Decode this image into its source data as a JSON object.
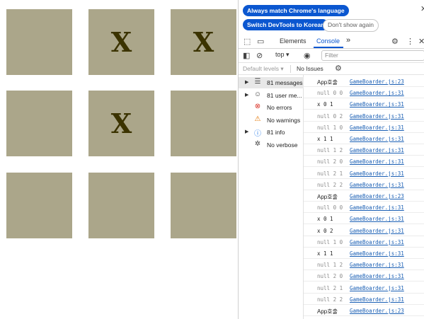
{
  "board": {
    "cells": [
      "",
      "X",
      "X",
      "",
      "X",
      "",
      "",
      "",
      ""
    ]
  },
  "devtools": {
    "banner": {
      "match_language": "Always match Chrome's language",
      "switch_korean": "Switch DevTools to Korean",
      "dont_show": "Don't show again"
    },
    "tabs": {
      "elements": "Elements",
      "console": "Console",
      "more": "»"
    },
    "toolbar": {
      "context": "top ▾",
      "filter_placeholder": "Filter"
    },
    "levels": "Default levels ▾",
    "issues": "No Issues",
    "sidebar": [
      {
        "label": "81 messages",
        "icon": "list-icon",
        "glyph": "☰",
        "arrow": true,
        "selected": true,
        "color": "#444444"
      },
      {
        "label": "81 user me...",
        "icon": "user-icon",
        "glyph": "☺",
        "arrow": true,
        "selected": false,
        "color": "#444444"
      },
      {
        "label": "No errors",
        "icon": "error-icon",
        "glyph": "⊗",
        "arrow": false,
        "selected": false,
        "color": "#d93025"
      },
      {
        "label": "No warnings",
        "icon": "warning-icon",
        "glyph": "⚠",
        "arrow": false,
        "selected": false,
        "color": "#e37400"
      },
      {
        "label": "81 info",
        "icon": "info-icon",
        "glyph": "ⓘ",
        "arrow": true,
        "selected": false,
        "color": "#1a73e8"
      },
      {
        "label": "No verbose",
        "icon": "bug-icon",
        "glyph": "✲",
        "arrow": false,
        "selected": false,
        "color": "#444444"
      }
    ],
    "log": [
      {
        "msg": "App호출",
        "src": "GameBoarder.js:23",
        "kind": "plain"
      },
      {
        "msg": "null 0 0",
        "src": "GameBoarder.js:31",
        "kind": "dim"
      },
      {
        "msg": "x 0 1",
        "src": "GameBoarder.js:31",
        "kind": "normal"
      },
      {
        "msg": "null 0 2",
        "src": "GameBoarder.js:31",
        "kind": "dim"
      },
      {
        "msg": "null 1 0",
        "src": "GameBoarder.js:31",
        "kind": "dim"
      },
      {
        "msg": "x 1 1",
        "src": "GameBoarder.js:31",
        "kind": "normal"
      },
      {
        "msg": "null 1 2",
        "src": "GameBoarder.js:31",
        "kind": "dim"
      },
      {
        "msg": "null 2 0",
        "src": "GameBoarder.js:31",
        "kind": "dim"
      },
      {
        "msg": "null 2 1",
        "src": "GameBoarder.js:31",
        "kind": "dim"
      },
      {
        "msg": "null 2 2",
        "src": "GameBoarder.js:31",
        "kind": "dim"
      },
      {
        "msg": "App호출",
        "src": "GameBoarder.js:23",
        "kind": "plain"
      },
      {
        "msg": "null 0 0",
        "src": "GameBoarder.js:31",
        "kind": "dim"
      },
      {
        "msg": "x 0 1",
        "src": "GameBoarder.js:31",
        "kind": "normal"
      },
      {
        "msg": "x 0 2",
        "src": "GameBoarder.js:31",
        "kind": "normal"
      },
      {
        "msg": "null 1 0",
        "src": "GameBoarder.js:31",
        "kind": "dim"
      },
      {
        "msg": "x 1 1",
        "src": "GameBoarder.js:31",
        "kind": "normal"
      },
      {
        "msg": "null 1 2",
        "src": "GameBoarder.js:31",
        "kind": "dim"
      },
      {
        "msg": "null 2 0",
        "src": "GameBoarder.js:31",
        "kind": "dim"
      },
      {
        "msg": "null 2 1",
        "src": "GameBoarder.js:31",
        "kind": "dim"
      },
      {
        "msg": "null 2 2",
        "src": "GameBoarder.js:31",
        "kind": "dim"
      },
      {
        "msg": "App호출",
        "src": "GameBoarder.js:23",
        "kind": "plain"
      }
    ]
  }
}
